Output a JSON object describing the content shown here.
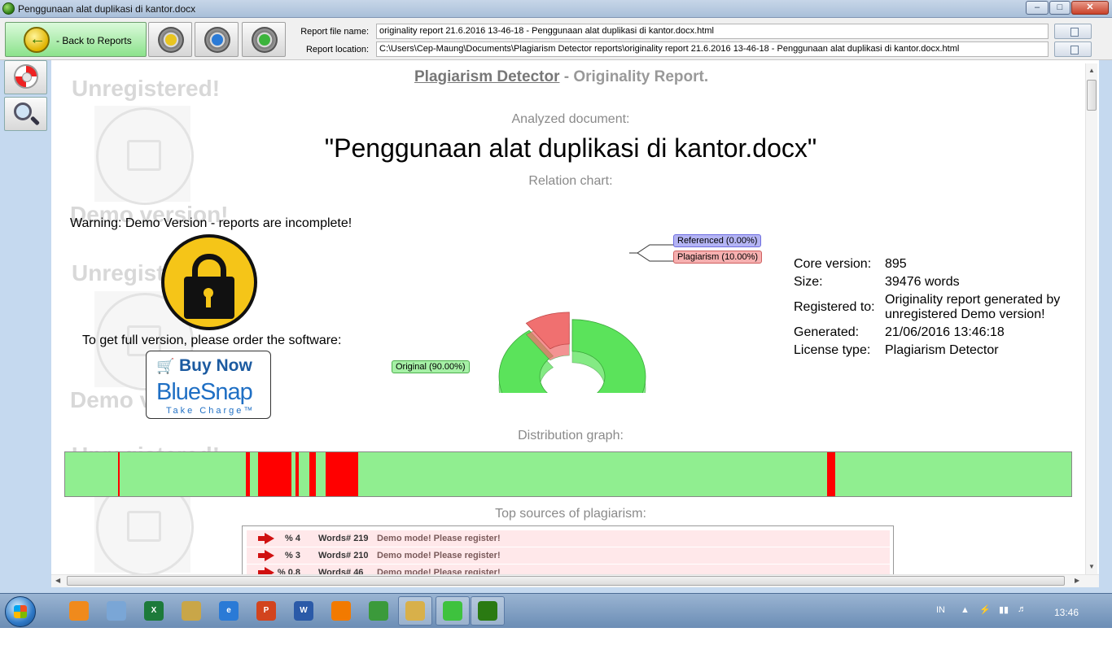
{
  "window": {
    "title": "Penggunaan alat duplikasi di kantor.docx",
    "controls": {
      "minimize": "–",
      "maximize": "□",
      "close": "✕"
    }
  },
  "toolbar": {
    "back_label": "- Back to Reports",
    "report_file_label": "Report file name:",
    "report_file_value": "originality report 21.6.2016 13-46-18 - Penggunaan alat duplikasi di kantor.docx.html",
    "report_location_label": "Report location:",
    "report_location_value": "C:\\Users\\Cep-Maung\\Documents\\Plagiarism Detector reports\\originality report 21.6.2016 13-46-18 - Penggunaan alat duplikasi di kantor.docx.html"
  },
  "report": {
    "heading_app": "Plagiarism Detector",
    "heading_rest": " - Originality Report.",
    "watermark_unregistered": "Unregistered!",
    "watermark_demo": "Demo version!",
    "analyzed_label": "Analyzed document:",
    "doc_name": "\"Penggunaan alat duplikasi di kantor.docx\"",
    "relation_label": "Relation chart:",
    "warning": "Warning: Demo Version - reports are incomplete!",
    "order_text": "To get full version, please order the software:",
    "buy": {
      "cart": "🛒",
      "label": "Buy Now",
      "brand": "BlueSnap",
      "tagline": "Take Charge™"
    },
    "distribution_label": "Distribution graph:",
    "top_sources_label": "Top sources of plagiarism:"
  },
  "relation_chart": {
    "type": "pie",
    "slices": [
      {
        "label": "Original (90.00%)",
        "value": 90.0,
        "color": "#5be35b"
      },
      {
        "label": "Plagiarism (10.00%)",
        "value": 10.0,
        "color": "#f07070"
      },
      {
        "label": "Referenced (0.00%)",
        "value": 0.0,
        "color": "#8c8cf0"
      }
    ]
  },
  "properties": [
    {
      "key": "Core version:",
      "value": "895"
    },
    {
      "key": "Size:",
      "value": "39476 words"
    },
    {
      "key": "Registered to:",
      "value": "Originality report generated by unregistered Demo version!"
    },
    {
      "key": "Generated:",
      "value": "21/06/2016 13:46:18"
    },
    {
      "key": "License type:",
      "value": "Plagiarism Detector"
    }
  ],
  "distribution": {
    "segments": [
      {
        "start": 0.0525,
        "end": 0.0545
      },
      {
        "start": 0.1797,
        "end": 0.1838
      },
      {
        "start": 0.1918,
        "end": 0.2246
      },
      {
        "start": 0.2286,
        "end": 0.2326
      },
      {
        "start": 0.2431,
        "end": 0.2488
      },
      {
        "start": 0.2592,
        "end": 0.2915
      },
      {
        "start": 0.7573,
        "end": 0.7654
      }
    ],
    "color_match": "#ff0000",
    "color_clean": "#90ee90"
  },
  "sources": [
    {
      "pct": "% 4",
      "words": "Words# 219",
      "desc": "Demo mode! Please register!"
    },
    {
      "pct": "% 3",
      "words": "Words# 210",
      "desc": "Demo mode! Please register!"
    },
    {
      "pct": "% 0.8",
      "words": "Words# 46",
      "desc": "Demo mode! Please register!"
    }
  ],
  "taskbar": {
    "apps": [
      {
        "name": "firefox-icon",
        "glyph": "",
        "color": "#f08a1c"
      },
      {
        "name": "notepad-icon",
        "glyph": "",
        "color": "#7aa6d6"
      },
      {
        "name": "excel-icon",
        "glyph": "X",
        "color": "#1d7a3a"
      },
      {
        "name": "tools-icon",
        "glyph": "",
        "color": "#c9a648"
      },
      {
        "name": "ie-icon",
        "glyph": "e",
        "color": "#2a7ad6"
      },
      {
        "name": "powerpoint-icon",
        "glyph": "P",
        "color": "#d2441e"
      },
      {
        "name": "word-icon",
        "glyph": "W",
        "color": "#2b5aa8"
      },
      {
        "name": "vlc-icon",
        "glyph": "",
        "color": "#f27a00"
      },
      {
        "name": "chrome-icon",
        "glyph": "",
        "color": "#3b9a3b"
      },
      {
        "name": "explorer-icon",
        "glyph": "",
        "color": "#d8b04a"
      },
      {
        "name": "chat-icon",
        "glyph": "",
        "color": "#3ec23e"
      },
      {
        "name": "plagiarism-detector-icon",
        "glyph": "",
        "color": "#2a7a12"
      }
    ],
    "language": "IN",
    "clock": "13:46"
  }
}
